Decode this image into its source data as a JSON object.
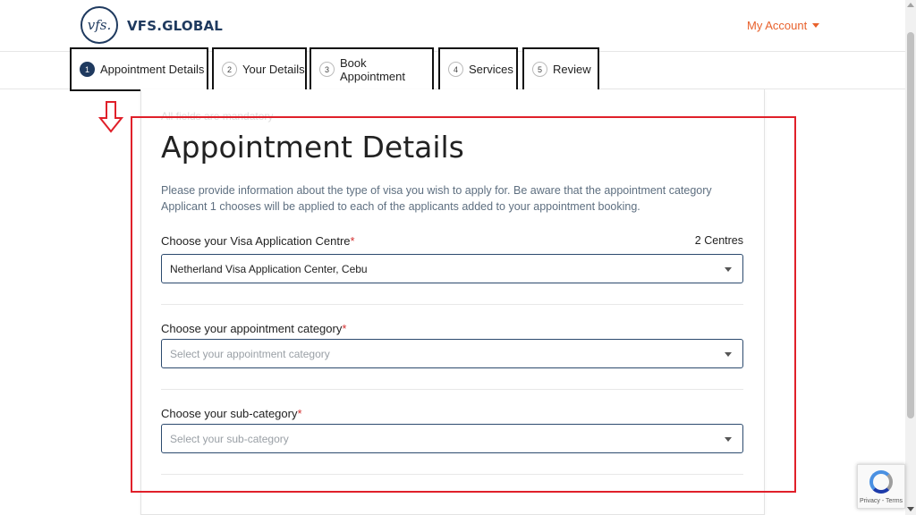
{
  "header": {
    "logo_mark": "vfs.",
    "logo_text": "VFS.GLOBAL",
    "my_account_label": "My Account"
  },
  "stepper": {
    "steps": [
      {
        "number": "1",
        "label": "Appointment Details"
      },
      {
        "number": "2",
        "label": "Your Details"
      },
      {
        "number": "3",
        "label": "Book Appointment"
      },
      {
        "number": "4",
        "label": "Services"
      },
      {
        "number": "5",
        "label": "Review"
      }
    ],
    "active_step": 1
  },
  "form": {
    "mandatory_note": "All fields are mandatory",
    "title": "Appointment Details",
    "intro_line1": "Please provide information about the type of visa you wish to apply for. Be aware that the appointment category",
    "intro_line2": "Applicant 1 chooses will be applied to each of the applicants added to your appointment booking.",
    "centre": {
      "label": "Choose your Visa Application Centre",
      "count": "2 Centres",
      "value": "Netherland Visa Application Center, Cebu"
    },
    "category": {
      "label": "Choose your appointment category",
      "placeholder": "Select your appointment category"
    },
    "subcategory": {
      "label": "Choose your sub-category",
      "placeholder": "Select your sub-category"
    },
    "required_mark": "*"
  },
  "recaptcha": {
    "footer": "Privacy - Terms"
  },
  "colors": {
    "brand_navy": "#1f3a5f",
    "accent_orange": "#e8612c",
    "annotation_red": "#e0202a",
    "required_red": "#d32f2f"
  }
}
